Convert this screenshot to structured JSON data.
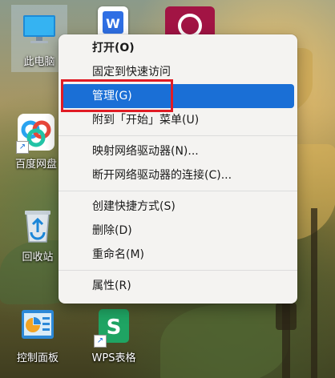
{
  "desktop": {
    "icons": [
      {
        "id": "this-pc",
        "label": "此电脑",
        "icon": "monitor-icon"
      },
      {
        "id": "baidu-netdisk",
        "label": "百度网盘",
        "icon": "baidu-netdisk-icon"
      },
      {
        "id": "recycle-bin",
        "label": "回收站",
        "icon": "recycle-bin-icon"
      },
      {
        "id": "control-panel",
        "label": "控制面板",
        "icon": "control-panel-icon"
      },
      {
        "id": "wps-sheets",
        "label": "WPS表格",
        "icon": "wps-sheets-icon"
      }
    ]
  },
  "context_menu": {
    "items": [
      {
        "label": "打开(O)"
      },
      {
        "label": "固定到快速访问"
      },
      {
        "label": "管理(G)"
      },
      {
        "label": "附到「开始」菜单(U)"
      },
      {
        "label": "映射网络驱动器(N)..."
      },
      {
        "label": "断开网络驱动器的连接(C)..."
      },
      {
        "label": "创建快捷方式(S)"
      },
      {
        "label": "删除(D)"
      },
      {
        "label": "重命名(M)"
      },
      {
        "label": "属性(R)"
      }
    ]
  },
  "colors": {
    "menu_highlight": "#1a6fd6",
    "annotation_box": "#e01b24"
  }
}
